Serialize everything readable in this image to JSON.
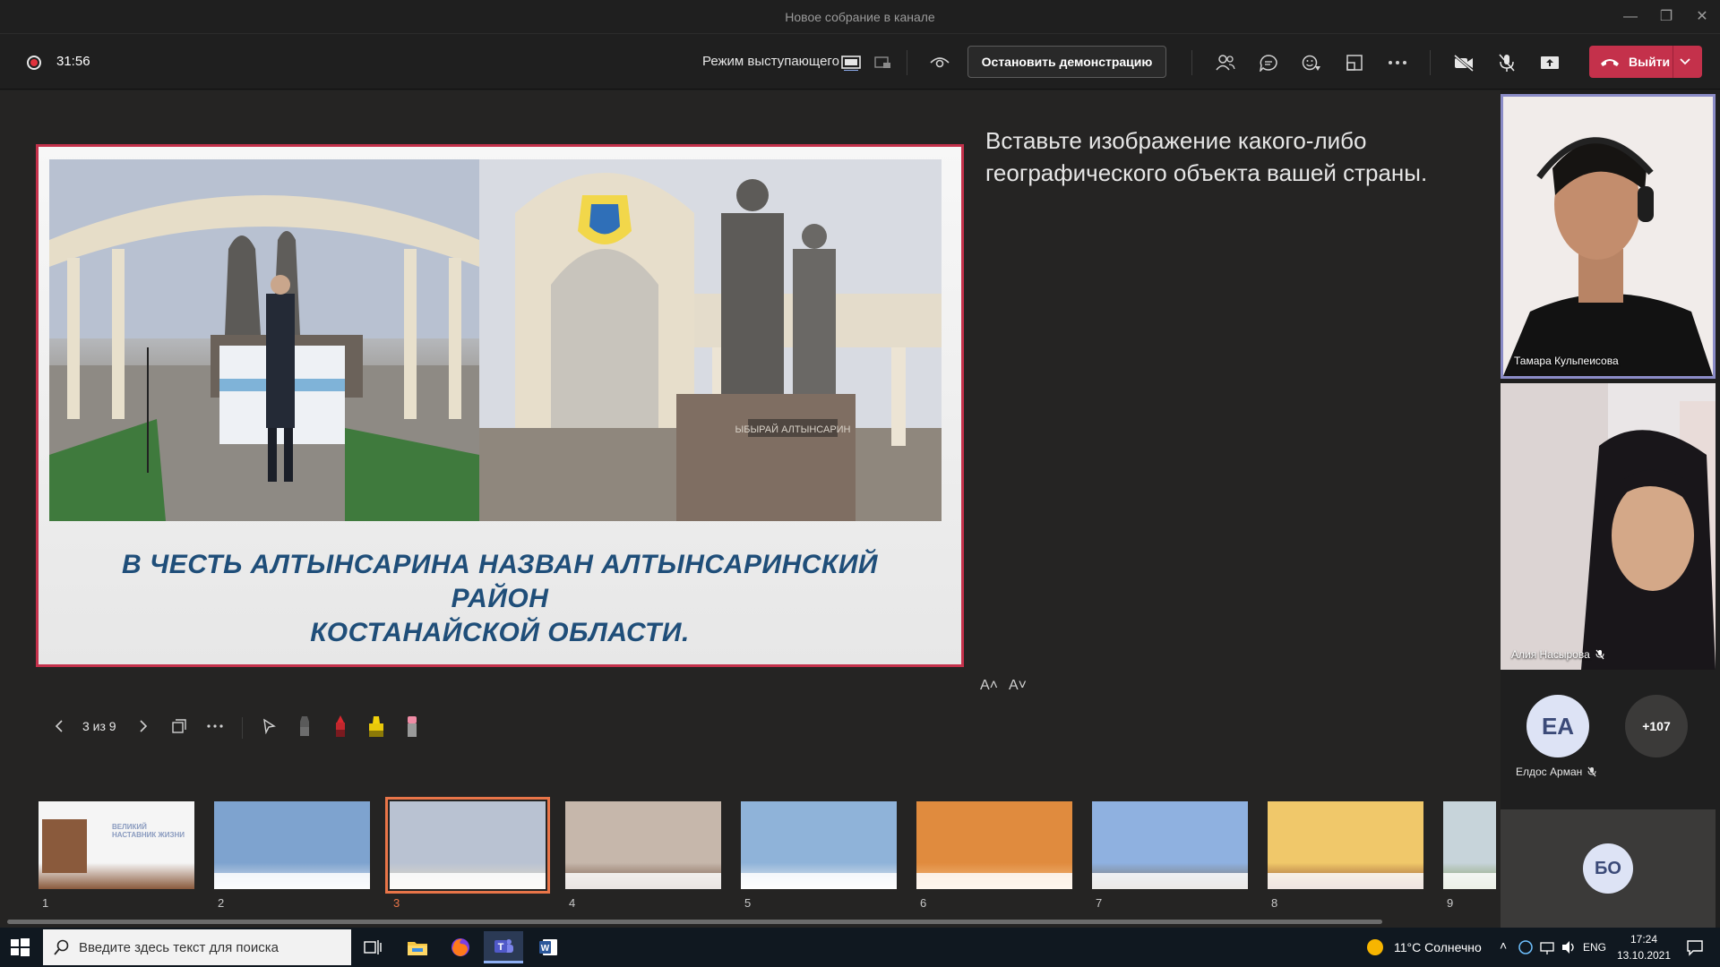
{
  "window": {
    "title": "Новое собрание в канале",
    "controls": [
      "minimize-icon",
      "restore-icon",
      "close-icon"
    ]
  },
  "toolbar": {
    "recording_timer": "31:56",
    "presenter_mode_label": "Режим выступающего",
    "stop_share_label": "Остановить демонстрацию",
    "leave_label": "Выйти",
    "icons": [
      "participants-icon",
      "chat-icon",
      "reactions-icon",
      "rooms-icon",
      "more-icon",
      "camera-off-icon",
      "mic-off-icon",
      "share-icon"
    ],
    "accent_leave": "#c4314b"
  },
  "slide": {
    "caption": "В ЧЕСТЬ АЛТЫНСАРИНА НАЗВАН АЛТЫНСАРИНСКИЙ РАЙОН КОСТАНАЙСКОЙ ОБЛАСТИ.",
    "caption_line1": "В ЧЕСТЬ АЛТЫНСАРИНА НАЗВАН АЛТЫНСАРИНСКИЙ РАЙОН",
    "caption_line2": "КОСТАНАЙСКОЙ ОБЛАСТИ.",
    "monument_plaque": "ЫБЫРАЙ АЛТЫНСАРИН",
    "border_color": "#c4314b"
  },
  "notes": {
    "text": "Вставьте изображение какого-либо географического объекта вашей страны.",
    "font_increase": "A˄",
    "font_decrease": "A˅"
  },
  "navigation": {
    "page_indicator": "3 из 9",
    "tools": [
      "prev-icon",
      "next-icon",
      "grid-icon",
      "more-icon",
      "pointer-icon",
      "pen-black-icon",
      "pen-red-icon",
      "highlighter-icon",
      "eraser-icon"
    ]
  },
  "thumbnails": [
    {
      "num": "1",
      "title": "ВЕЛИКИЙ НАСТАВНИК ЖИЗНИ"
    },
    {
      "num": "2"
    },
    {
      "num": "3",
      "selected": true
    },
    {
      "num": "4"
    },
    {
      "num": "5"
    },
    {
      "num": "6"
    },
    {
      "num": "7"
    },
    {
      "num": "8"
    },
    {
      "num": "9"
    }
  ],
  "participants": {
    "video": [
      {
        "name": "Тамара Кульпеисова"
      },
      {
        "name": "Алия Насырова"
      }
    ],
    "avatars": [
      {
        "initials": "ЕА",
        "name": "Елдос Арман"
      },
      {
        "initials": "+107"
      }
    ],
    "bottom_tile": {
      "initials": "БО"
    },
    "active_speaker_color": "#8b8cc7"
  },
  "taskbar": {
    "search_placeholder": "Введите здесь текст для поиска",
    "weather": "11°C  Солнечно",
    "language": "ENG",
    "time": "17:24",
    "date": "13.10.2021"
  }
}
